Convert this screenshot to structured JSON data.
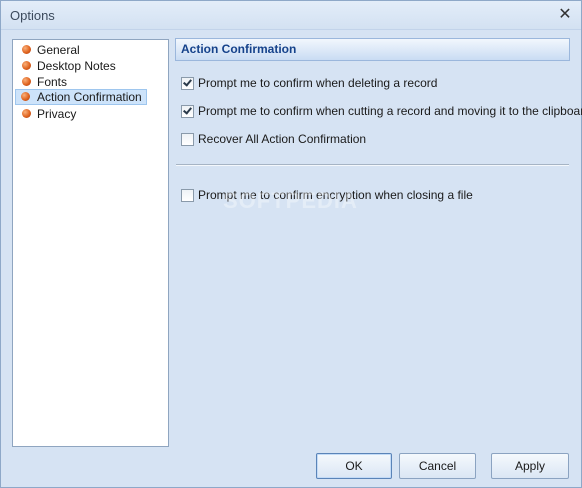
{
  "window": {
    "title": "Options"
  },
  "sidebar": {
    "items": [
      {
        "label": "General"
      },
      {
        "label": "Desktop Notes"
      },
      {
        "label": "Fonts"
      },
      {
        "label": "Action Confirmation"
      },
      {
        "label": "Privacy"
      }
    ],
    "selected_index": 3
  },
  "main": {
    "header": "Action Confirmation",
    "options": [
      {
        "label": "Prompt me to confirm when deleting a record",
        "checked": true
      },
      {
        "label": "Prompt me to confirm when cutting a record and moving it to the clipboard",
        "checked": true
      },
      {
        "label": "Recover All Action Confirmation",
        "checked": false
      },
      {
        "label": "Prompt me to confirm encryption when closing a file",
        "checked": false
      }
    ]
  },
  "buttons": {
    "ok": "OK",
    "cancel": "Cancel",
    "apply": "Apply"
  },
  "watermark": "SOFTPEDIA",
  "colors": {
    "accent": "#15428b",
    "background": "#d6e3f3",
    "selection": "#cde3fa"
  }
}
